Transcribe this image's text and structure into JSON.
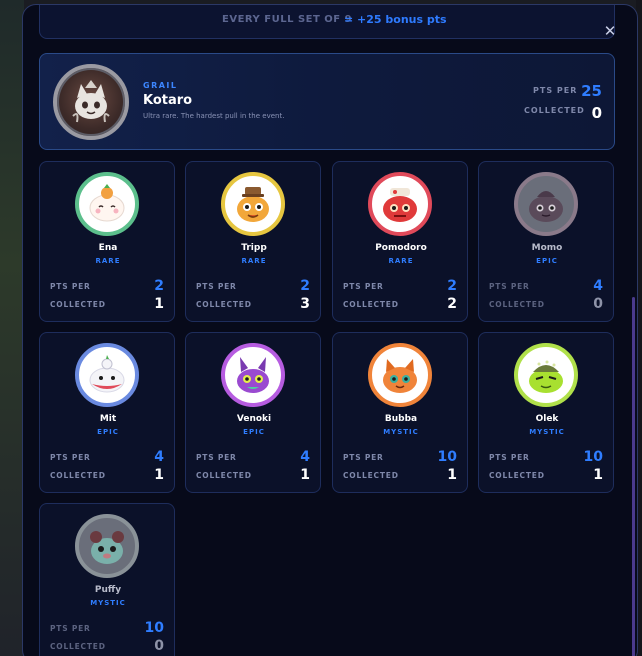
{
  "banner": {
    "text": "EVERY FULL SET OF 9",
    "bonus": "= +25 bonus pts"
  },
  "close_icon": "close-icon",
  "grail": {
    "tier": "GRAIL",
    "name": "Kotaro",
    "description": "Ultra rare. The hardest pull in the event.",
    "pts_label": "PTS PER",
    "pts": "25",
    "collected_label": "COLLECTED",
    "collected": "0"
  },
  "labels": {
    "pts_per": "PTS PER",
    "collected": "COLLECTED"
  },
  "cards": [
    {
      "name": "Ena",
      "tier": "RARE",
      "pts": "2",
      "collected": "1",
      "ring": "#5cbf8c"
    },
    {
      "name": "Tripp",
      "tier": "RARE",
      "pts": "2",
      "collected": "3",
      "ring": "#e6c640"
    },
    {
      "name": "Pomodoro",
      "tier": "RARE",
      "pts": "2",
      "collected": "2",
      "ring": "#e04a5a"
    },
    {
      "name": "Momo",
      "tier": "EPIC",
      "pts": "4",
      "collected": "0",
      "ring": "#9a8a9a"
    },
    {
      "name": "Mit",
      "tier": "EPIC",
      "pts": "4",
      "collected": "1",
      "ring": "#6a8ae0"
    },
    {
      "name": "Venoki",
      "tier": "EPIC",
      "pts": "4",
      "collected": "1",
      "ring": "#b65ce0"
    },
    {
      "name": "Bubba",
      "tier": "MYSTIC",
      "pts": "10",
      "collected": "1",
      "ring": "#f0843a"
    },
    {
      "name": "Olek",
      "tier": "MYSTIC",
      "pts": "10",
      "collected": "1",
      "ring": "#b0e04a"
    },
    {
      "name": "Puffy",
      "tier": "MYSTIC",
      "pts": "10",
      "collected": "0",
      "ring": "#9aa2a8"
    }
  ]
}
